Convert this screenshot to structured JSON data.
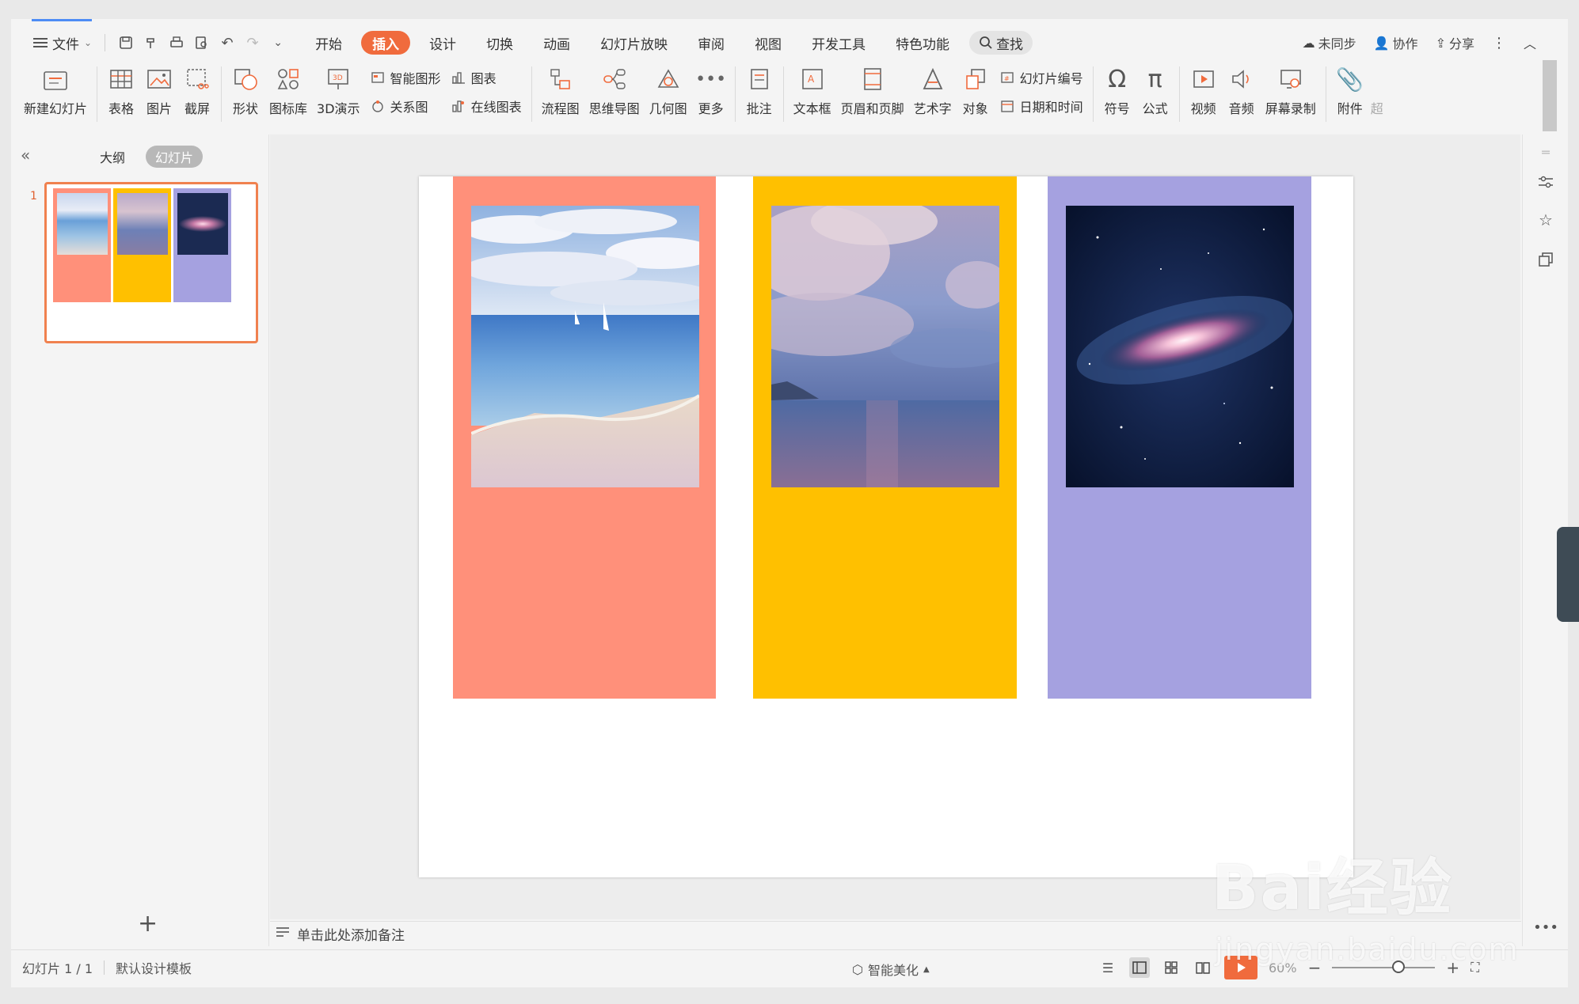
{
  "menubar": {
    "file_label": "文件",
    "tabs": [
      "开始",
      "插入",
      "设计",
      "切换",
      "动画",
      "幻灯片放映",
      "审阅",
      "视图",
      "开发工具",
      "特色功能"
    ],
    "active_tab": "插入",
    "search_label": "查找",
    "sync_label": "未同步",
    "collab_label": "协作",
    "share_label": "分享"
  },
  "ribbon": {
    "new_slide": "新建幻灯片",
    "table": "表格",
    "picture": "图片",
    "screenshot": "截屏",
    "shape": "形状",
    "icon_lib": "图标库",
    "demo3d": "3D演示",
    "smart_graphic": "智能图形",
    "chart": "图表",
    "relation": "关系图",
    "online_chart": "在线图表",
    "flowchart": "流程图",
    "mindmap": "思维导图",
    "geometry": "几何图",
    "more": "更多",
    "comment": "批注",
    "textbox": "文本框",
    "header_footer": "页眉和页脚",
    "wordart": "艺术字",
    "object": "对象",
    "slide_number": "幻灯片编号",
    "datetime": "日期和时间",
    "symbol": "符号",
    "formula": "公式",
    "video": "视频",
    "audio": "音频",
    "screen_record": "屏幕录制",
    "attachment": "附件",
    "hyper": "超"
  },
  "leftpanel": {
    "tab_outline": "大纲",
    "tab_slides": "幻灯片",
    "slide_number": "1"
  },
  "slide": {
    "colors": {
      "coral": "#ff907a",
      "yellow": "#ffc000",
      "lavender": "#a5a1e0"
    },
    "columns": [
      {
        "name": "coral-column",
        "color": "#ff907a",
        "photo": "beach-photo"
      },
      {
        "name": "yellow-column",
        "color": "#ffc000",
        "photo": "sky-photo"
      },
      {
        "name": "lavender-column",
        "color": "#a5a1e0",
        "photo": "galaxy-photo"
      }
    ]
  },
  "notes": {
    "placeholder": "单击此处添加备注"
  },
  "statusbar": {
    "slide_counter": "幻灯片 1 / 1",
    "template": "默认设计模板",
    "beautify": "智能美化",
    "zoom": "60%"
  },
  "watermark": {
    "main": "Bai经验",
    "sub": "jingyan.baidu.com"
  }
}
